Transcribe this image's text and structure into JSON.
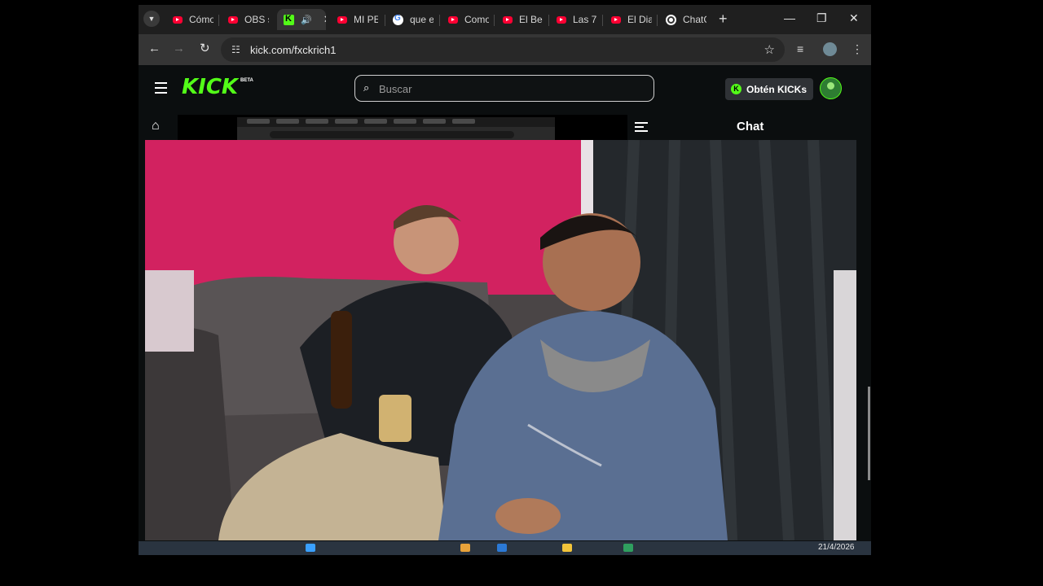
{
  "tabs": [
    {
      "label": "Cómo",
      "icon": "youtube-icon"
    },
    {
      "label": "OBS s",
      "icon": "youtube-icon"
    },
    {
      "label": "",
      "icon": "kick-icon",
      "active": true
    },
    {
      "label": "MI PE",
      "icon": "youtube-icon"
    },
    {
      "label": "que e",
      "icon": "google-icon"
    },
    {
      "label": "Como",
      "icon": "youtube-icon"
    },
    {
      "label": "El Be",
      "icon": "youtube-icon"
    },
    {
      "label": "Las 7",
      "icon": "youtube-icon"
    },
    {
      "label": "El Dia",
      "icon": "youtube-icon"
    },
    {
      "label": "ChatG",
      "icon": "openai-icon"
    }
  ],
  "address_bar": {
    "url": "kick.com/fxckrich1"
  },
  "kick": {
    "logo_text": "KICK",
    "logo_badge": "BETA",
    "search_placeholder": "Buscar",
    "get_kicks_label": "Obtén KICKs",
    "chat_title": "Chat"
  },
  "taskbar": {
    "date": "21/4/2026"
  },
  "colors": {
    "kick_green": "#53fc18",
    "youtube_red": "#ff0033",
    "page_bg": "#0b0e0f",
    "browser_chrome": "#1f1f1f"
  }
}
